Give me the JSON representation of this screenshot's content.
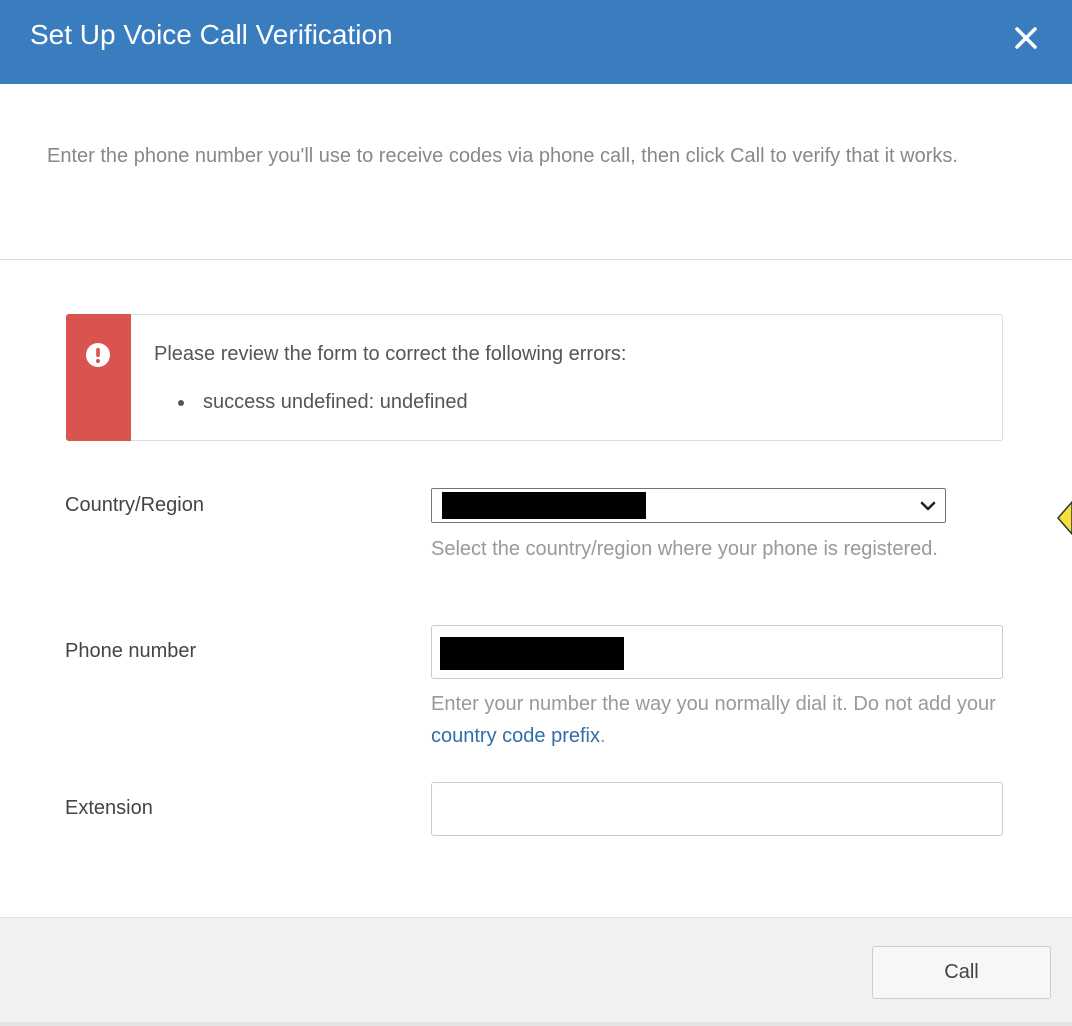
{
  "dialog": {
    "title": "Set Up Voice Call Verification",
    "close_icon": "close-icon",
    "intro": "Enter the phone number you'll use to receive codes via phone call, then click Call to verify that it works."
  },
  "alert": {
    "icon": "exclamation-circle-icon",
    "heading": "Please review the form to correct the following errors:",
    "errors": [
      "success undefined: undefined"
    ],
    "color": "#d9534f"
  },
  "form": {
    "country": {
      "label": "Country/Region",
      "help": "Select the country/region where your phone is registered."
    },
    "phone": {
      "label": "Phone number",
      "help_prefix": "Enter your number the way you normally dial it. Do not add your ",
      "help_link": "country code prefix",
      "help_suffix": "."
    },
    "extension": {
      "label": "Extension",
      "value": ""
    }
  },
  "footer": {
    "call_label": "Call"
  },
  "colors": {
    "header": "#3a7dbe",
    "link": "#2f6ea8"
  }
}
